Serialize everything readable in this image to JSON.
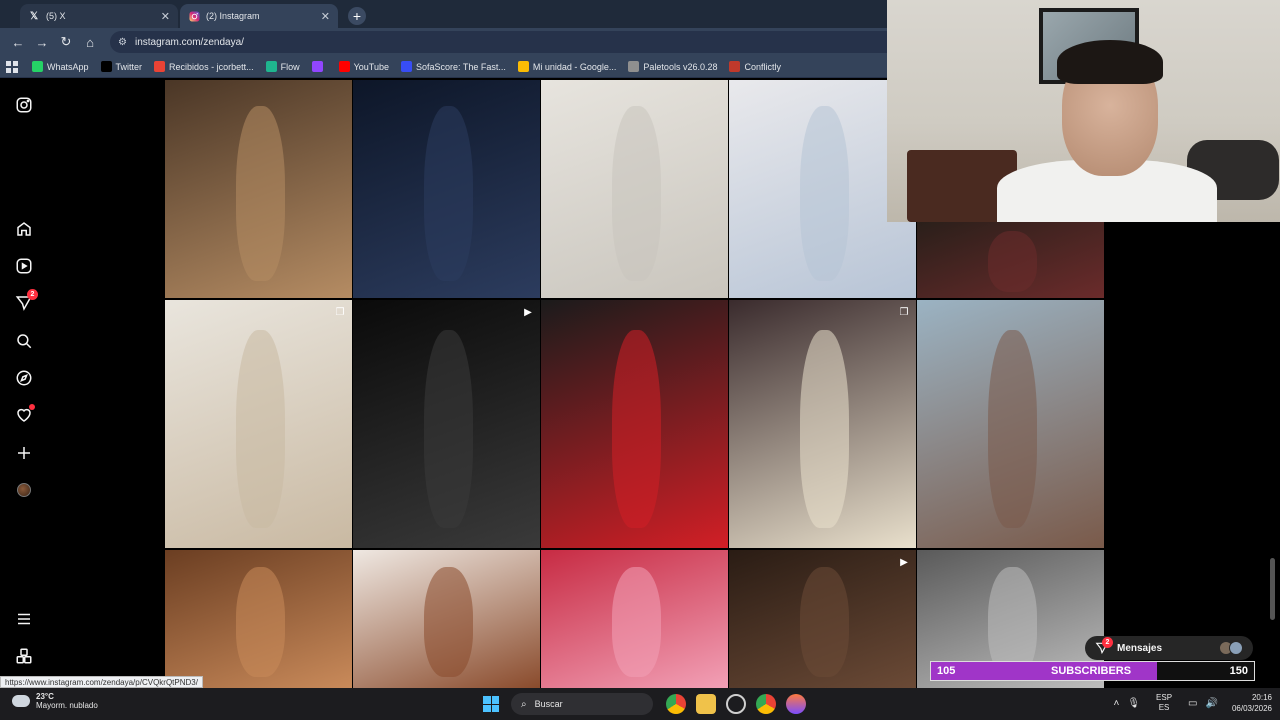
{
  "browser": {
    "tabs": [
      {
        "title": "(5) X",
        "icon": "x-logo-icon"
      },
      {
        "title": "(2) Instagram",
        "icon": "instagram-logo-icon"
      }
    ],
    "url": "instagram.com/zendaya/",
    "bookmarks": [
      {
        "label": "WhatsApp",
        "color": "#25d366"
      },
      {
        "label": "Twitter",
        "color": "#000000"
      },
      {
        "label": "Recibidos - jcorbett...",
        "color": "#ea4335"
      },
      {
        "label": "Flow",
        "color": "#1fb58f"
      },
      {
        "label": "",
        "color": "#9146ff"
      },
      {
        "label": "YouTube",
        "color": "#ff0000"
      },
      {
        "label": "SofaScore: The Fast...",
        "color": "#374df5"
      },
      {
        "label": "Mi unidad - Google...",
        "color": "#fbbc04"
      },
      {
        "label": "Paletools v26.0.28",
        "color": "#8f8f8f"
      },
      {
        "label": "Conflictly",
        "color": "#c0392b"
      }
    ]
  },
  "instagram": {
    "nav": [
      {
        "name": "instagram-logo-icon"
      },
      {
        "name": "home-icon"
      },
      {
        "name": "reels-icon"
      },
      {
        "name": "messages-icon",
        "badge": "2"
      },
      {
        "name": "search-icon"
      },
      {
        "name": "explore-icon"
      },
      {
        "name": "notifications-icon",
        "dot": true
      },
      {
        "name": "create-icon"
      },
      {
        "name": "profile-avatar"
      },
      {
        "name": "more-menu-icon"
      },
      {
        "name": "also-from-meta-icon"
      }
    ],
    "status_url": "https://www.instagram.com/zendaya/p/CVQkrQtPND3/",
    "posts": [
      {
        "colors": [
          "#4a3626",
          "#b58c63"
        ],
        "type": "none"
      },
      {
        "colors": [
          "#0d1628",
          "#2c3c5e"
        ],
        "type": "none"
      },
      {
        "colors": [
          "#e7e4de",
          "#c9c5bd"
        ],
        "type": "none"
      },
      {
        "colors": [
          "#e9e9ec",
          "#b7c4d6"
        ],
        "type": "none"
      },
      {
        "colors": [
          "#2a1f1a",
          "#6b2b2b"
        ],
        "type": "none"
      },
      {
        "colors": [
          "#e9e5dd",
          "#c9b9a2"
        ],
        "type": "carousel"
      },
      {
        "colors": [
          "#0a0a0a",
          "#3a3a3a"
        ],
        "type": "video"
      },
      {
        "colors": [
          "#1b1b1b",
          "#d21f26"
        ],
        "type": "none"
      },
      {
        "colors": [
          "#3a2b2d",
          "#e9e0cc"
        ],
        "type": "carousel"
      },
      {
        "colors": [
          "#9bb3c3",
          "#7a5a4a"
        ],
        "type": "none"
      },
      {
        "colors": [
          "#6b3e22",
          "#c98a5a"
        ],
        "type": "none"
      },
      {
        "colors": [
          "#efe8e2",
          "#8a4b2c"
        ],
        "type": "none"
      },
      {
        "colors": [
          "#c72b43",
          "#f2a0b6"
        ],
        "type": "none"
      },
      {
        "colors": [
          "#2a1c14",
          "#6b4a36"
        ],
        "type": "video"
      },
      {
        "colors": [
          "#5a5a5a",
          "#bdbdbd"
        ],
        "type": "none"
      }
    ]
  },
  "stream": {
    "messages_label": "Mensajes",
    "messages_badge": "2",
    "subs_current": "105",
    "subs_label": "SUBSCRIBERS",
    "subs_goal": "150",
    "subs_progress": 0.7
  },
  "taskbar": {
    "weather_temp": "23°C",
    "weather_desc": "Mayorm. nublado",
    "search_placeholder": "Buscar",
    "lang_top": "ESP",
    "lang_bottom": "ES",
    "time": "20:16",
    "date": "06/03/2026"
  }
}
